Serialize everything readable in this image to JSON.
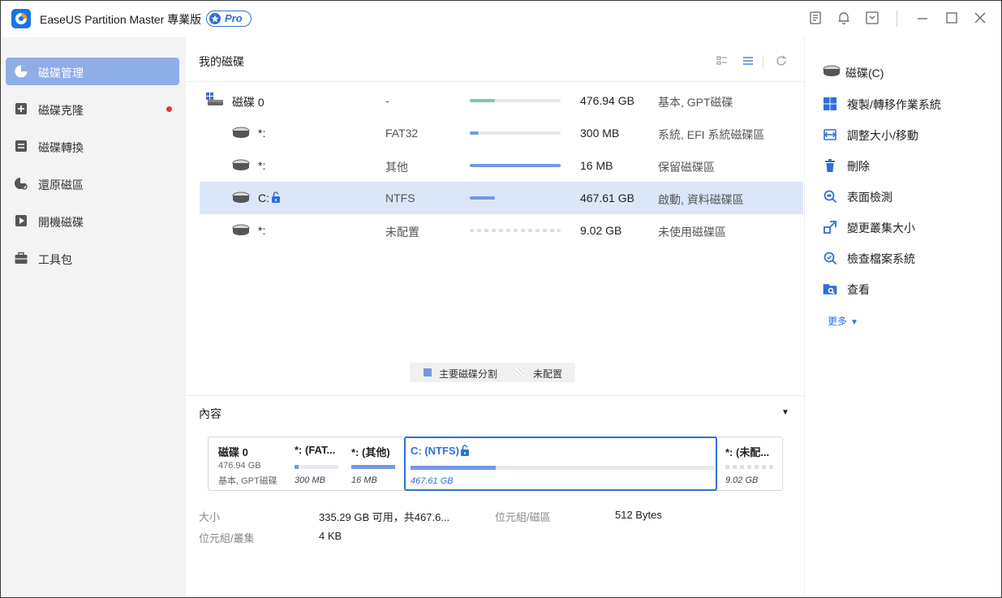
{
  "app": {
    "title": "EaseUS Partition Master 專業版",
    "badge": "Pro",
    "accent": "#2f6fd8"
  },
  "titlebar_icons": [
    "notes-icon",
    "bell-icon",
    "download-icon",
    "minimize-icon",
    "maximize-icon",
    "close-icon"
  ],
  "sidebar": {
    "items": [
      {
        "label": "磁碟管理",
        "icon": "pie-chart-icon",
        "active": true
      },
      {
        "label": "磁碟克隆",
        "icon": "clone-icon",
        "dot": true
      },
      {
        "label": "磁碟轉換",
        "icon": "convert-icon"
      },
      {
        "label": "還原磁區",
        "icon": "recover-icon"
      },
      {
        "label": "開機磁碟",
        "icon": "boot-disk-icon"
      },
      {
        "label": "工具包",
        "icon": "toolbox-icon"
      }
    ]
  },
  "main": {
    "title": "我的磁碟",
    "rows": [
      {
        "name": "磁碟 0",
        "fs": "-",
        "usage": 0.28,
        "bar_color": "#7cc6b0",
        "size": "476.94 GB",
        "type": "基本, GPT磁碟"
      },
      {
        "name": "*:",
        "fs": "FAT32",
        "usage": 0.1,
        "bar_color": "#7299e0",
        "size": "300 MB",
        "type": "系統, EFI 系統磁碟區"
      },
      {
        "name": "*:",
        "fs": "其他",
        "usage": 1.0,
        "bar_color": "#7299e0",
        "size": "16 MB",
        "type": "保留磁碟區"
      },
      {
        "name": "C:",
        "fs": "NTFS",
        "usage": 0.28,
        "bar_color": "#7299e0",
        "size": "467.61 GB",
        "type": "啟動, 資料磁碟區",
        "selected": true
      },
      {
        "name": "*:",
        "fs": "未配置",
        "usage": 0,
        "size": "9.02 GB",
        "type": "未使用磁碟區"
      }
    ],
    "legend": {
      "primary": "主要磁碟分割",
      "unallocated": "未配置"
    }
  },
  "content": {
    "title": "內容",
    "disk_map": [
      {
        "title": "磁碟 0",
        "line1": "476.94 GB",
        "line2": "基本, GPT磁碟"
      },
      {
        "title": "*: (FAT...",
        "usage": 0.1,
        "size": "300 MB"
      },
      {
        "title": "*: (其他)",
        "usage": 1.0,
        "size": "16 MB"
      },
      {
        "title": "C: (NTFS)",
        "usage": 0.28,
        "size": "467.61 GB",
        "selected": true
      },
      {
        "title": "*: (未配...",
        "usage": 0,
        "size": "9.02 GB"
      }
    ],
    "info": {
      "size_label": "大小",
      "size_value": "335.29 GB 可用，共467.6...",
      "bytes_sector_label": "位元組/磁區",
      "bytes_sector_value": "512 Bytes",
      "bytes_cluster_label": "位元組/叢集",
      "bytes_cluster_value": "4 KB"
    }
  },
  "operations": {
    "items": [
      {
        "label": "磁碟(C)",
        "icon": "disk-icon"
      },
      {
        "label": "複製/轉移作業系統",
        "icon": "windows-icon"
      },
      {
        "label": "調整大小/移動",
        "icon": "resize-icon"
      },
      {
        "label": "刪除",
        "icon": "trash-icon"
      },
      {
        "label": "表面檢測",
        "icon": "surface-test-icon"
      },
      {
        "label": "變更叢集大小",
        "icon": "cluster-icon"
      },
      {
        "label": "檢查檔案系統",
        "icon": "check-fs-icon"
      },
      {
        "label": "查看",
        "icon": "explore-icon"
      }
    ],
    "more": "更多"
  }
}
